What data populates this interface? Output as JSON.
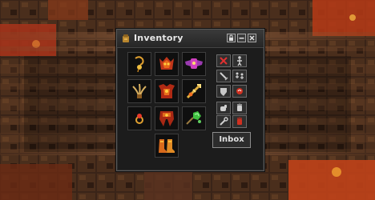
{
  "window": {
    "title": "Inventory"
  },
  "buttons": {
    "inbox_label": "Inbox"
  },
  "slots": [
    {
      "name": "amulet-slot",
      "item": "amulet-icon"
    },
    {
      "name": "helmet-slot",
      "item": "demon-helmet-icon"
    },
    {
      "name": "backpack-slot",
      "item": "winged-backpack-icon"
    },
    {
      "name": "left-hand-slot",
      "item": "claw-weapon-icon"
    },
    {
      "name": "armor-slot",
      "item": "demon-armor-icon"
    },
    {
      "name": "right-hand-slot",
      "item": "golden-wand-icon"
    },
    {
      "name": "ring-slot",
      "item": "ring-icon"
    },
    {
      "name": "legs-slot",
      "item": "demon-legs-icon"
    },
    {
      "name": "ammo-slot",
      "item": "green-crystal-icon"
    },
    {
      "name": "boots-slot",
      "item": "golden-boots-icon"
    }
  ],
  "controls": [
    {
      "name": "stop-attack-button",
      "icon": "red-cross-icon"
    },
    {
      "name": "stand-stance-button",
      "icon": "standing-figure-icon"
    },
    {
      "name": "full-attack-button",
      "icon": "sword-icon"
    },
    {
      "name": "follow-button",
      "icon": "two-figures-icon"
    },
    {
      "name": "defense-button",
      "icon": "shield-icon"
    },
    {
      "name": "chase-button",
      "icon": "red-swirl-icon"
    },
    {
      "name": "skills-button",
      "icon": "fist-icon"
    },
    {
      "name": "secure-mode-button",
      "icon": "hand-stop-icon"
    },
    {
      "name": "options-button",
      "icon": "tool-icon"
    },
    {
      "name": "pvp-mode-button",
      "icon": "red-hand-icon"
    }
  ],
  "colors": {
    "window_bg": "#1c1c1c",
    "border": "#5a5a5a",
    "title_text": "#e8e8e8",
    "lava": "#c23a12"
  }
}
